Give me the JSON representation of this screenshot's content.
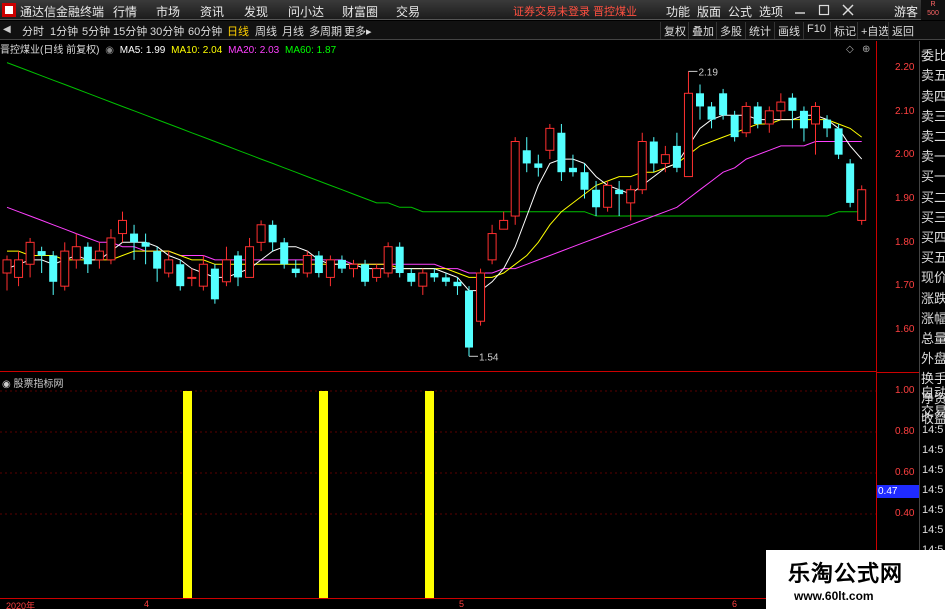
{
  "app": {
    "title": "通达信金融终端"
  },
  "menu": {
    "items": [
      "行情",
      "市场",
      "资讯",
      "发现",
      "问小达",
      "财富圈",
      "交易"
    ],
    "notice": "证券交易未登录  晋控煤业",
    "right": [
      "功能",
      "版面",
      "公式",
      "选项"
    ],
    "user": "游客",
    "badge_top": "R",
    "badge_bottom": "500"
  },
  "toolbar": {
    "periods": [
      "分时",
      "1分钟",
      "5分钟",
      "15分钟",
      "30分钟",
      "60分钟",
      "日线",
      "周线",
      "月线",
      "多周期",
      "更多"
    ],
    "active_period": "日线",
    "right": [
      "复权",
      "叠加",
      "多股",
      "统计",
      "画线",
      "F10",
      "标记",
      "+自选",
      "返回"
    ]
  },
  "chart": {
    "stock_title": "晋控煤业(日线 前复权)",
    "ma": [
      {
        "label": "MA5: 1.99",
        "color": "#ffffff"
      },
      {
        "label": "MA10: 2.04",
        "color": "#ffff00"
      },
      {
        "label": "MA20: 2.03",
        "color": "#ff40ff"
      },
      {
        "label": "MA60: 1.87",
        "color": "#00ff00"
      }
    ],
    "high_label": "2.19",
    "low_label": "1.54",
    "y_ticks": [
      "2.20",
      "2.10",
      "2.00",
      "1.90",
      "1.80",
      "1.70",
      "1.60"
    ]
  },
  "sub_chart": {
    "title": "股票指标网",
    "y_ticks": [
      "1.00",
      "0.80",
      "0.60",
      "0.40"
    ],
    "current_value": "0.47"
  },
  "side": {
    "labels": [
      "委比",
      "卖五",
      "卖四",
      "卖三",
      "卖二",
      "卖一",
      "买一",
      "买二",
      "买三",
      "买四",
      "买五",
      "现价",
      "涨跌",
      "涨幅",
      "总量",
      "外盘",
      "换手",
      "净资",
      "收益",
      "自动",
      "交易"
    ],
    "times": [
      "14:5",
      "14:5",
      "14:5",
      "14:5",
      "14:5",
      "14:5",
      "14:5"
    ]
  },
  "date_axis": {
    "labels": [
      "2020年",
      "4",
      "5",
      "6"
    ]
  },
  "colors": {
    "up": "#ff3030",
    "down": "#54ffff",
    "ma5": "#ffffff",
    "ma10": "#ffff00",
    "ma20": "#ff40ff",
    "ma60": "#00c000",
    "signal": "#ffff00"
  },
  "chart_data": {
    "type": "candlestick",
    "y_range": [
      1.55,
      2.23
    ],
    "sub_y_range": [
      0,
      1.05
    ],
    "candles": [
      [
        1.73,
        1.76,
        1.77,
        1.69
      ],
      [
        1.72,
        1.76,
        1.78,
        1.7
      ],
      [
        1.75,
        1.8,
        1.81,
        1.72
      ],
      [
        1.78,
        1.77,
        1.79,
        1.73
      ],
      [
        1.77,
        1.71,
        1.78,
        1.68
      ],
      [
        1.7,
        1.78,
        1.8,
        1.69
      ],
      [
        1.76,
        1.79,
        1.82,
        1.74
      ],
      [
        1.79,
        1.75,
        1.8,
        1.73
      ],
      [
        1.76,
        1.78,
        1.8,
        1.74
      ],
      [
        1.76,
        1.81,
        1.83,
        1.75
      ],
      [
        1.82,
        1.85,
        1.87,
        1.8
      ],
      [
        1.82,
        1.8,
        1.84,
        1.76
      ],
      [
        1.8,
        1.79,
        1.82,
        1.75
      ],
      [
        1.78,
        1.74,
        1.79,
        1.71
      ],
      [
        1.73,
        1.76,
        1.78,
        1.72
      ],
      [
        1.75,
        1.7,
        1.76,
        1.69
      ],
      [
        1.72,
        1.72,
        1.74,
        1.7
      ],
      [
        1.7,
        1.75,
        1.77,
        1.69
      ],
      [
        1.74,
        1.67,
        1.75,
        1.66
      ],
      [
        1.71,
        1.76,
        1.79,
        1.7
      ],
      [
        1.77,
        1.72,
        1.78,
        1.7
      ],
      [
        1.72,
        1.79,
        1.81,
        1.72
      ],
      [
        1.8,
        1.84,
        1.85,
        1.78
      ],
      [
        1.84,
        1.8,
        1.85,
        1.78
      ],
      [
        1.8,
        1.75,
        1.81,
        1.74
      ],
      [
        1.74,
        1.73,
        1.76,
        1.72
      ],
      [
        1.73,
        1.77,
        1.78,
        1.72
      ],
      [
        1.77,
        1.73,
        1.78,
        1.72
      ],
      [
        1.72,
        1.76,
        1.77,
        1.7
      ],
      [
        1.76,
        1.74,
        1.77,
        1.73
      ],
      [
        1.74,
        1.75,
        1.76,
        1.72
      ],
      [
        1.75,
        1.71,
        1.76,
        1.7
      ],
      [
        1.72,
        1.74,
        1.75,
        1.71
      ],
      [
        1.73,
        1.79,
        1.8,
        1.72
      ],
      [
        1.79,
        1.73,
        1.8,
        1.72
      ],
      [
        1.73,
        1.71,
        1.74,
        1.7
      ],
      [
        1.7,
        1.73,
        1.74,
        1.68
      ],
      [
        1.73,
        1.72,
        1.74,
        1.71
      ],
      [
        1.72,
        1.71,
        1.73,
        1.7
      ],
      [
        1.71,
        1.7,
        1.72,
        1.68
      ],
      [
        1.69,
        1.56,
        1.7,
        1.54
      ],
      [
        1.62,
        1.73,
        1.74,
        1.61
      ],
      [
        1.76,
        1.82,
        1.84,
        1.75
      ],
      [
        1.83,
        1.85,
        1.87,
        1.83
      ],
      [
        1.86,
        2.03,
        2.04,
        1.84
      ],
      [
        2.01,
        1.98,
        2.04,
        1.96
      ],
      [
        1.98,
        1.97,
        2.0,
        1.95
      ],
      [
        2.01,
        2.06,
        2.07,
        1.99
      ],
      [
        2.05,
        1.96,
        2.07,
        1.94
      ],
      [
        1.97,
        1.96,
        2.0,
        1.95
      ],
      [
        1.96,
        1.92,
        1.98,
        1.9
      ],
      [
        1.92,
        1.88,
        1.94,
        1.86
      ],
      [
        1.88,
        1.93,
        1.94,
        1.87
      ],
      [
        1.92,
        1.91,
        1.94,
        1.86
      ],
      [
        1.89,
        1.92,
        1.93,
        1.85
      ],
      [
        1.92,
        2.03,
        2.05,
        1.91
      ],
      [
        2.03,
        1.98,
        2.04,
        1.96
      ],
      [
        1.98,
        2.0,
        2.02,
        1.96
      ],
      [
        2.02,
        1.97,
        2.05,
        1.96
      ],
      [
        1.95,
        2.14,
        2.19,
        1.95
      ],
      [
        2.14,
        2.11,
        2.16,
        2.08
      ],
      [
        2.11,
        2.08,
        2.12,
        2.06
      ],
      [
        2.14,
        2.09,
        2.15,
        2.08
      ],
      [
        2.09,
        2.04,
        2.1,
        2.03
      ],
      [
        2.05,
        2.11,
        2.12,
        2.04
      ],
      [
        2.11,
        2.07,
        2.12,
        2.06
      ],
      [
        2.07,
        2.1,
        2.11,
        2.05
      ],
      [
        2.1,
        2.12,
        2.14,
        2.08
      ],
      [
        2.13,
        2.1,
        2.14,
        2.06
      ],
      [
        2.1,
        2.06,
        2.11,
        2.03
      ],
      [
        2.07,
        2.11,
        2.12,
        2.0
      ],
      [
        2.08,
        2.06,
        2.09,
        2.04
      ],
      [
        2.06,
        2.0,
        2.07,
        1.99
      ],
      [
        1.98,
        1.89,
        1.99,
        1.88
      ],
      [
        1.85,
        1.92,
        1.93,
        1.84
      ]
    ],
    "ma5": [
      1.74,
      1.75,
      1.76,
      1.76,
      1.75,
      1.76,
      1.77,
      1.76,
      1.76,
      1.78,
      1.8,
      1.8,
      1.8,
      1.79,
      1.77,
      1.76,
      1.74,
      1.73,
      1.72,
      1.72,
      1.73,
      1.74,
      1.76,
      1.78,
      1.79,
      1.79,
      1.78,
      1.76,
      1.75,
      1.75,
      1.75,
      1.74,
      1.74,
      1.74,
      1.74,
      1.74,
      1.74,
      1.74,
      1.73,
      1.72,
      1.69,
      1.69,
      1.71,
      1.74,
      1.79,
      1.86,
      1.93,
      1.98,
      1.99,
      1.99,
      1.98,
      1.95,
      1.93,
      1.92,
      1.91,
      1.93,
      1.95,
      1.97,
      1.98,
      2.02,
      2.06,
      2.08,
      2.09,
      2.09,
      2.09,
      2.08,
      2.08,
      2.08,
      2.08,
      2.09,
      2.09,
      2.08,
      2.06,
      2.02,
      1.99
    ],
    "ma10": [
      1.78,
      1.78,
      1.77,
      1.77,
      1.77,
      1.76,
      1.76,
      1.76,
      1.76,
      1.76,
      1.77,
      1.78,
      1.78,
      1.78,
      1.78,
      1.77,
      1.76,
      1.76,
      1.75,
      1.75,
      1.75,
      1.75,
      1.75,
      1.75,
      1.75,
      1.75,
      1.75,
      1.75,
      1.75,
      1.75,
      1.75,
      1.75,
      1.75,
      1.75,
      1.74,
      1.74,
      1.74,
      1.74,
      1.74,
      1.73,
      1.72,
      1.72,
      1.72,
      1.73,
      1.75,
      1.77,
      1.8,
      1.84,
      1.87,
      1.89,
      1.91,
      1.93,
      1.94,
      1.95,
      1.95,
      1.96,
      1.96,
      1.97,
      1.98,
      2.0,
      2.02,
      2.03,
      2.04,
      2.05,
      2.06,
      2.07,
      2.07,
      2.08,
      2.08,
      2.08,
      2.08,
      2.08,
      2.07,
      2.06,
      2.04
    ],
    "ma20": [
      1.88,
      1.87,
      1.86,
      1.85,
      1.84,
      1.83,
      1.82,
      1.81,
      1.8,
      1.8,
      1.79,
      1.79,
      1.78,
      1.78,
      1.78,
      1.77,
      1.77,
      1.77,
      1.76,
      1.76,
      1.76,
      1.76,
      1.76,
      1.76,
      1.76,
      1.76,
      1.76,
      1.76,
      1.76,
      1.76,
      1.75,
      1.75,
      1.75,
      1.75,
      1.75,
      1.75,
      1.75,
      1.75,
      1.74,
      1.74,
      1.73,
      1.73,
      1.73,
      1.74,
      1.74,
      1.75,
      1.76,
      1.77,
      1.78,
      1.79,
      1.8,
      1.81,
      1.82,
      1.83,
      1.84,
      1.85,
      1.86,
      1.87,
      1.88,
      1.9,
      1.92,
      1.94,
      1.96,
      1.97,
      1.99,
      2.0,
      2.01,
      2.02,
      2.02,
      2.02,
      2.03,
      2.03,
      2.03,
      2.03,
      2.03
    ],
    "ma60": [
      2.21,
      2.2,
      2.19,
      2.18,
      2.17,
      2.16,
      2.15,
      2.14,
      2.13,
      2.12,
      2.11,
      2.1,
      2.09,
      2.08,
      2.07,
      2.06,
      2.05,
      2.04,
      2.03,
      2.02,
      2.01,
      2.0,
      1.99,
      1.98,
      1.97,
      1.96,
      1.95,
      1.94,
      1.93,
      1.92,
      1.91,
      1.9,
      1.89,
      1.89,
      1.88,
      1.88,
      1.87,
      1.87,
      1.87,
      1.87,
      1.87,
      1.87,
      1.87,
      1.87,
      1.87,
      1.87,
      1.87,
      1.87,
      1.87,
      1.87,
      1.87,
      1.86,
      1.86,
      1.86,
      1.86,
      1.86,
      1.86,
      1.86,
      1.86,
      1.86,
      1.86,
      1.86,
      1.86,
      1.86,
      1.86,
      1.86,
      1.86,
      1.86,
      1.86,
      1.86,
      1.86,
      1.86,
      1.87,
      1.87,
      1.87
    ],
    "signals": [
      {
        "index": 12,
        "value": 1.0
      },
      {
        "index": 21,
        "value": 1.0
      },
      {
        "index": 28,
        "value": 1.0
      }
    ]
  }
}
